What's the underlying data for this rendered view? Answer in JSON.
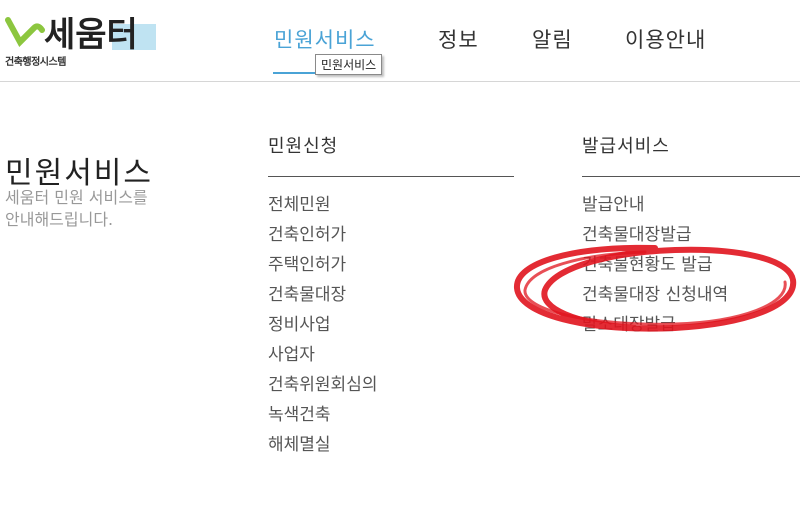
{
  "header": {
    "logo_text": "세움터",
    "logo_sub": "건축행정시스템",
    "nav": [
      {
        "label": "민원서비스",
        "active": true
      },
      {
        "label": "정보"
      },
      {
        "label": "알림"
      },
      {
        "label": "이용안내"
      }
    ],
    "tooltip": "민원서비스"
  },
  "section": {
    "title": "민원서비스",
    "desc": "세움터 민원 서비스를\n안내해드립니다."
  },
  "columns": [
    {
      "heading": "민원신청",
      "items": [
        "전체민원",
        "건축인허가",
        "주택인허가",
        "건축물대장",
        "정비사업",
        "사업자",
        "건축위원회심의",
        "녹색건축",
        "해체멸실"
      ]
    },
    {
      "heading": "발급서비스",
      "items": [
        "발급안내",
        "건축물대장발급",
        "건축물현황도 발급",
        "건축물대장 신청내역",
        "말소대장발급"
      ]
    }
  ],
  "colors": {
    "accent": "#4aa3d6",
    "annotation": "#e0141e",
    "logo_green": "#8cc63f",
    "logo_blue": "#bfe3f2"
  }
}
